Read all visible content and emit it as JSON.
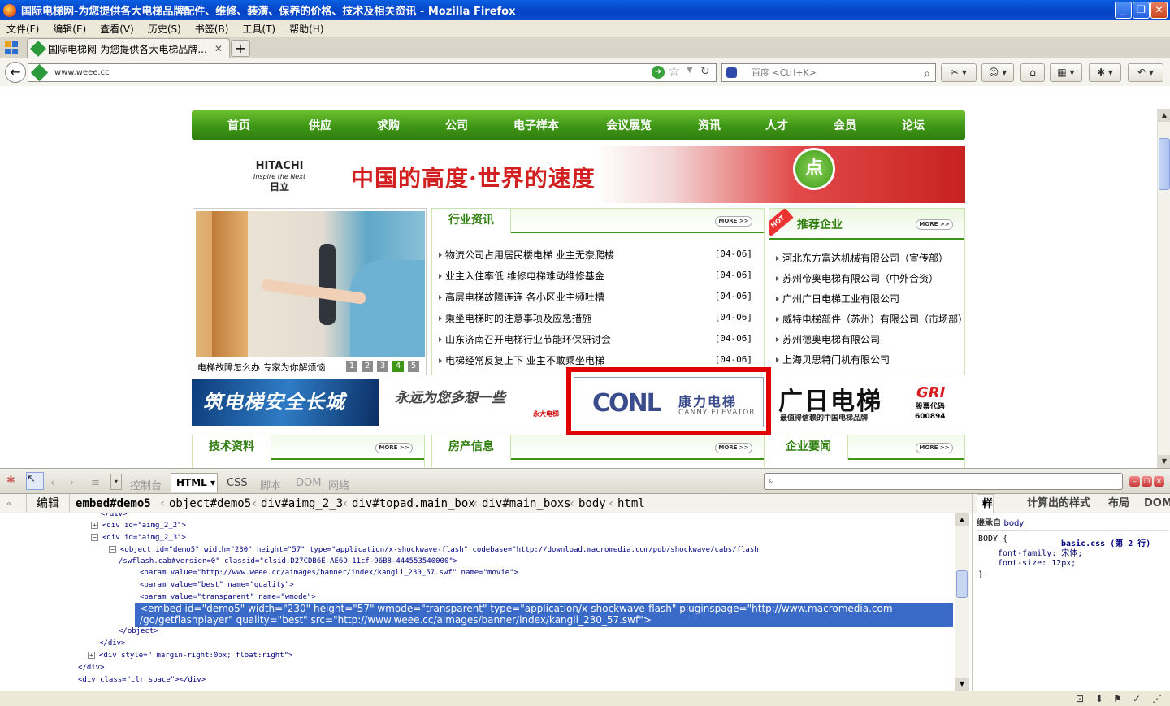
{
  "window": {
    "title": "国际电梯网-为您提供各大电梯品牌配件、维修、装潢、保养的价格、技术及相关资讯 - Mozilla Firefox"
  },
  "menu": [
    "文件(F)",
    "编辑(E)",
    "查看(V)",
    "历史(S)",
    "书签(B)",
    "工具(T)",
    "帮助(H)"
  ],
  "tab": {
    "label": "国际电梯网-为您提供各大电梯品牌..."
  },
  "address": {
    "url": "www.weee.cc"
  },
  "search": {
    "placeholder": "百度 <Ctrl+K>"
  },
  "site": {
    "nav": [
      "首页",
      "供应",
      "求购",
      "公司",
      "电子样本",
      "会议展览",
      "资讯",
      "人才",
      "会员",
      "论坛"
    ],
    "banner": {
      "brand": "HITACHI",
      "brand_sub": "Inspire the Next",
      "brand_cn": "日立",
      "slogan": "中国的高度·世界的速度",
      "badge": "点"
    },
    "photo": {
      "caption": "电梯故障怎么办 专家为你解烦恼",
      "pages": [
        "1",
        "2",
        "3",
        "4",
        "5"
      ],
      "active_page": "4"
    },
    "news": {
      "title": "行业资讯",
      "more": "MORE >>",
      "items": [
        {
          "text": "物流公司占用居民楼电梯 业主无奈爬楼",
          "date": "[04-06]"
        },
        {
          "text": "业主入住率低 维修电梯难动维修基金",
          "date": "[04-06]"
        },
        {
          "text": "高层电梯故障连连 各小区业主频吐槽",
          "date": "[04-06]"
        },
        {
          "text": "乘坐电梯时的注意事项及应急措施",
          "date": "[04-06]"
        },
        {
          "text": "山东济南召开电梯行业节能环保研讨会",
          "date": "[04-06]"
        },
        {
          "text": "电梯经常反复上下 业主不敢乘坐电梯",
          "date": "[04-06]"
        }
      ]
    },
    "companies": {
      "badge": "HOT",
      "title": "推荐企业",
      "more": "MORE >>",
      "items": [
        "河北东方富达机械有限公司（宣传部）",
        "苏州帝奥电梯有限公司（中外合资）",
        "广州广日电梯工业有限公司",
        "威特电梯部件（苏州）有限公司（市场部）",
        "苏州德奥电梯有限公司",
        "上海贝思特门机有限公司"
      ]
    },
    "ads": {
      "ad1": "筑电梯安全长城",
      "ad2": "永远为您多想一些",
      "ad2_brand": "永大电梯",
      "kangli_logo": "CONL",
      "kangli_cn": "康力电梯",
      "kangli_en": "CANNY ELEVATOR",
      "gr_big": "广日电梯",
      "gr_sub": "最值得信赖的中国电梯品牌",
      "gr_logo": "GRI",
      "gr_code_label": "股票代码",
      "gr_code": "600894"
    },
    "sections": [
      {
        "title": "技术资料",
        "more": "MORE >>"
      },
      {
        "title": "房产信息",
        "more": "MORE >>"
      },
      {
        "title": "企业要闻",
        "more": "MORE >>"
      }
    ]
  },
  "firebug": {
    "tabs": [
      "控制台",
      "HTML",
      "CSS",
      "脚本",
      "DOM",
      "网络"
    ],
    "edit": "编辑",
    "breadcrumbs": [
      "embed#demo5",
      "object#demo5",
      "div#aimg_2_3",
      "div#topad.main_box",
      "div#main_boxs",
      "body",
      "html"
    ],
    "side_tabs": [
      "样式",
      "计算出的样式",
      "布局",
      "DOM"
    ],
    "source": [
      {
        "indent": 112,
        "toggle": "+",
        "text": "<div id=\"aimg_2_2\">"
      },
      {
        "indent": 112,
        "toggle": "-",
        "text": "<div id=\"aimg_2_3\">"
      },
      {
        "indent": 134,
        "toggle": "-",
        "text": "<object id=\"demo5\" width=\"230\" height=\"57\" type=\"application/x-shockwave-flash\" codebase=\"http://download.macromedia.com/pub/shockwave/cabs/flash"
      },
      {
        "indent": 146,
        "toggle": "",
        "text": "/swflash.cab#version=0\" classid=\"clsid:D27CDB6E-AE6D-11cf-96B8-444553540000\">"
      },
      {
        "indent": 172,
        "toggle": "",
        "text": "<param value=\"http://www.weee.cc/aimages/banner/index/kangli_230_57.swf\" name=\"movie\">"
      },
      {
        "indent": 172,
        "toggle": "",
        "text": "<param value=\"best\" name=\"quality\">"
      },
      {
        "indent": 172,
        "toggle": "",
        "text": "<param value=\"transparent\" name=\"wmode\">"
      },
      {
        "indent": 146,
        "toggle": "",
        "text": "</object>"
      },
      {
        "indent": 122,
        "toggle": "",
        "text": "</div>"
      },
      {
        "indent": 108,
        "toggle": "+",
        "text": "<div style=\" margin-right:0px; float:right\">"
      },
      {
        "indent": 96,
        "toggle": "",
        "text": "</div>"
      },
      {
        "indent": 96,
        "toggle": "",
        "text": "<div class=\"clr space\"></div>"
      }
    ],
    "selected": [
      "<embed id=\"demo5\" width=\"230\" height=\"57\" wmode=\"transparent\" type=\"application/x-shockwave-flash\" pluginspage=\"http://www.macromedia.com",
      "/go/getflashplayer\" quality=\"best\" src=\"http://www.weee.cc/aimages/banner/index/kangli_230_57.swf\">"
    ],
    "css": {
      "inherit_label": "继承自",
      "inherit_from": "body",
      "selector": "BODY {",
      "file": "basic.css (第 2 行)",
      "props": [
        "font-family: 宋体;",
        "font-size: 12px;"
      ],
      "close": "}"
    }
  },
  "colors": {
    "green": "#3e9616",
    "highlight": "#e00000",
    "selection": "#3a6bc8"
  }
}
